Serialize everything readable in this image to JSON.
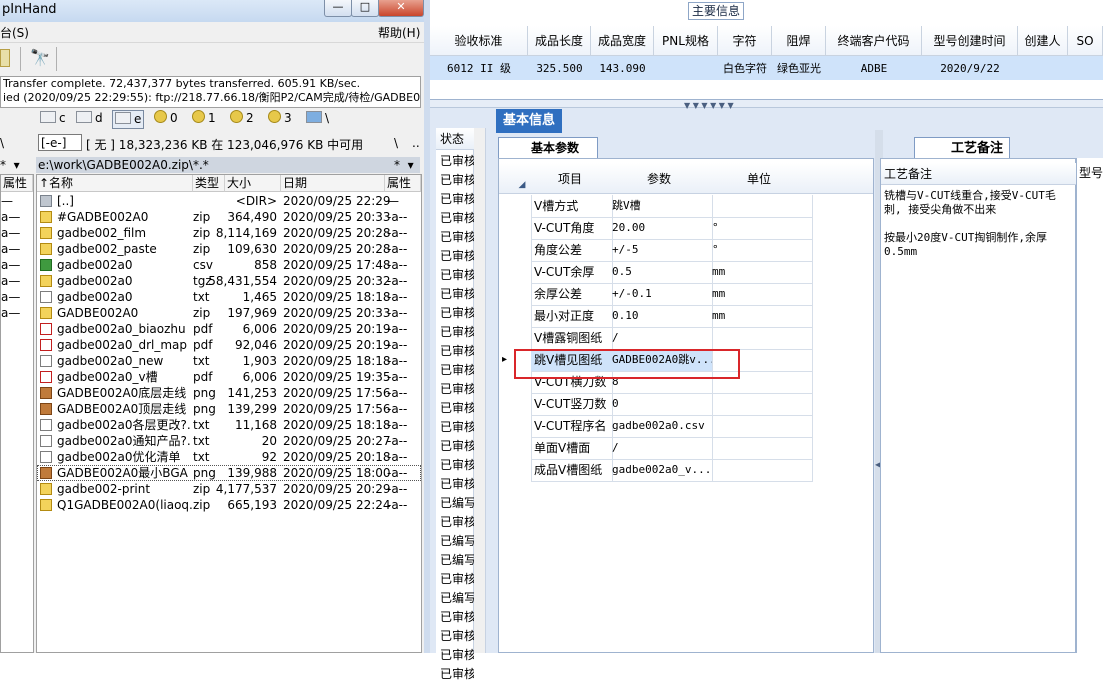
{
  "tc": {
    "title": "pInHand",
    "window_buttons": [
      "—",
      "□",
      "✕"
    ],
    "menu_left": "台(S)",
    "menu_right": "帮助(H)",
    "ftp_log": [
      "Transfer complete. 72,437,377 bytes transferred. 605.91 KB/sec.",
      "ied (2020/09/25 22:29:55): ftp://218.77.66.18/衡阳P2/CAM完成/待检/GADBE0("
    ],
    "drives": [
      "c",
      "d",
      "e",
      "0",
      "1",
      "2",
      "3",
      "\\"
    ],
    "path_bar": {
      "drive_combo": "[-e-]",
      "free_info": "[ 无 ]  18,323,236 KB 在 123,046,976 KB 中可用",
      "left_text": "\\",
      "backslash": "\\",
      "dotdot": ".."
    },
    "current_path": "e:\\work\\GADBE002A0.zip\\*.*",
    "columns": {
      "name": "↑名称",
      "ext": "类型",
      "size": "大小",
      "date": "日期",
      "attr": "属性"
    },
    "left_stub": {
      "header": "属性",
      "rows": [
        "—",
        "a—",
        "a—",
        "a—",
        "a—",
        "a—",
        "a—",
        "a—"
      ]
    },
    "files": [
      {
        "icon": "up",
        "name": "[..]",
        "ext": "",
        "size": "<DIR>",
        "date": "2020/09/25 22:29",
        "attr": "—"
      },
      {
        "icon": "zip",
        "name": "#GADBE002A0",
        "ext": "zip",
        "size": "364,490",
        "date": "2020/09/25 20:33",
        "attr": "-a--"
      },
      {
        "icon": "zip",
        "name": "gadbe002_film",
        "ext": "zip",
        "size": "8,114,169",
        "date": "2020/09/25 20:28",
        "attr": "-a--"
      },
      {
        "icon": "zip",
        "name": "gadbe002_paste",
        "ext": "zip",
        "size": "109,630",
        "date": "2020/09/25 20:28",
        "attr": "-a--"
      },
      {
        "icon": "csv",
        "name": "gadbe002a0",
        "ext": "csv",
        "size": "858",
        "date": "2020/09/25 17:48",
        "attr": "-a--"
      },
      {
        "icon": "zip",
        "name": "gadbe002a0",
        "ext": "tgz",
        "size": "58,431,554",
        "date": "2020/09/25 20:32",
        "attr": "-a--"
      },
      {
        "icon": "txt",
        "name": "gadbe002a0",
        "ext": "txt",
        "size": "1,465",
        "date": "2020/09/25 18:18",
        "attr": "-a--"
      },
      {
        "icon": "zip",
        "name": "GADBE002A0",
        "ext": "zip",
        "size": "197,969",
        "date": "2020/09/25 20:33",
        "attr": "-a--"
      },
      {
        "icon": "pdf",
        "name": "gadbe002a0_biaozhu",
        "ext": "pdf",
        "size": "6,006",
        "date": "2020/09/25 20:19",
        "attr": "-a--"
      },
      {
        "icon": "pdf",
        "name": "gadbe002a0_drl_map",
        "ext": "pdf",
        "size": "92,046",
        "date": "2020/09/25 20:19",
        "attr": "-a--"
      },
      {
        "icon": "txt",
        "name": "gadbe002a0_new",
        "ext": "txt",
        "size": "1,903",
        "date": "2020/09/25 18:18",
        "attr": "-a--"
      },
      {
        "icon": "pdf",
        "name": "gadbe002a0_v槽",
        "ext": "pdf",
        "size": "6,006",
        "date": "2020/09/25 19:35",
        "attr": "-a--"
      },
      {
        "icon": "png",
        "name": "GADBE002A0底层走线",
        "ext": "png",
        "size": "141,253",
        "date": "2020/09/25 17:56",
        "attr": "-a--"
      },
      {
        "icon": "png",
        "name": "GADBE002A0顶层走线",
        "ext": "png",
        "size": "139,299",
        "date": "2020/09/25 17:56",
        "attr": "-a--"
      },
      {
        "icon": "txt",
        "name": "gadbe002a0各层更改?.",
        "ext": "txt",
        "size": "11,168",
        "date": "2020/09/25 18:18",
        "attr": "-a--"
      },
      {
        "icon": "txt",
        "name": "gadbe002a0通知产品?.",
        "ext": "txt",
        "size": "20",
        "date": "2020/09/25 20:27",
        "attr": "-a--"
      },
      {
        "icon": "txt",
        "name": "gadbe002a0优化清单",
        "ext": "txt",
        "size": "92",
        "date": "2020/09/25 20:18",
        "attr": "-a--"
      },
      {
        "icon": "png",
        "name": "GADBE002A0最小BGA",
        "ext": "png",
        "size": "139,988",
        "date": "2020/09/25 18:00",
        "attr": "-a--"
      },
      {
        "icon": "zip",
        "name": "gadbe002-print",
        "ext": "zip",
        "size": "4,177,537",
        "date": "2020/09/25 20:29",
        "attr": "-a--"
      },
      {
        "icon": "zip",
        "name": "Q1GADBE002A0(liaoq..",
        "ext": "zip",
        "size": "665,193",
        "date": "2020/09/25 22:24",
        "attr": "-a--"
      }
    ]
  },
  "app": {
    "main_info_tab": "主要信息",
    "top_headers": [
      "验收标准",
      "成品长度",
      "成品宽度",
      "PNL规格",
      "字符",
      "阻焊",
      "终端客户代码",
      "型号创建时间",
      "创建人",
      "SO"
    ],
    "top_row": [
      "6012 II 级",
      "325.500",
      "143.090",
      "",
      "白色字符",
      "绿色亚光",
      "ADBE",
      "2020/9/22",
      "",
      ""
    ],
    "status_header": "状态",
    "status_items": [
      "已审核",
      "已审核",
      "已审核",
      "已审核",
      "已审核",
      "已审核",
      "已审核",
      "已审核",
      "已审核",
      "已审核",
      "已审核",
      "已审核",
      "已审核",
      "已审核",
      "已审核",
      "已审核",
      "已审核",
      "已审核",
      "已编写",
      "已审核",
      "已编写",
      "已编写",
      "已审核",
      "已编写",
      "已审核",
      "已审核",
      "已审核",
      "已审核"
    ],
    "basic_info_tab": "基本信息",
    "basic_params_tab": "基本参数",
    "param_headers": [
      "项目",
      "参数",
      "单位"
    ],
    "params": [
      {
        "item": "V槽方式",
        "value": "跳V槽",
        "unit": ""
      },
      {
        "item": "V-CUT角度",
        "value": "20.00",
        "unit": "°"
      },
      {
        "item": "角度公差",
        "value": "+/-5",
        "unit": "°"
      },
      {
        "item": "V-CUT余厚",
        "value": "0.5",
        "unit": "mm"
      },
      {
        "item": "余厚公差",
        "value": "+/-0.1",
        "unit": "mm"
      },
      {
        "item": "最小对正度",
        "value": "0.10",
        "unit": "mm"
      },
      {
        "item": "V槽露铜图纸",
        "value": "/",
        "unit": ""
      },
      {
        "item": "跳V槽见图纸",
        "value": "GADBE002A0跳v...",
        "unit": ""
      },
      {
        "item": "V-CUT横刀数",
        "value": "8",
        "unit": ""
      },
      {
        "item": "V-CUT竖刀数",
        "value": "0",
        "unit": ""
      },
      {
        "item": "V-CUT程序名",
        "value": "gadbe002a0.csv",
        "unit": ""
      },
      {
        "item": "单面V槽面",
        "value": "/",
        "unit": ""
      },
      {
        "item": "成品V槽图纸",
        "value": "gadbe002a0_v...",
        "unit": ""
      }
    ],
    "craft_tab": "工艺备注",
    "craft_header": "工艺备注",
    "craft_text": "铣槽与V-CUT线重合,接受V-CUT毛刺, 接受尖角做不出来\n\n按最小20度V-CUT掏铜制作,余厚0.5mm",
    "type_header": "型号",
    "highlight_color": "#d9262a"
  }
}
